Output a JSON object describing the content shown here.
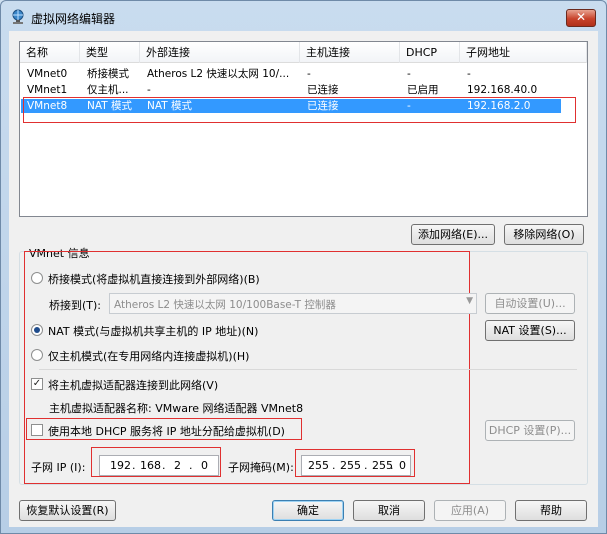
{
  "window": {
    "title": "虚拟网络编辑器"
  },
  "table": {
    "columns": [
      "名称",
      "类型",
      "外部连接",
      "主机连接",
      "DHCP",
      "子网地址"
    ],
    "rows": [
      [
        "VMnet0",
        "桥接模式",
        "Atheros L2 快速以太网 10/...",
        "-",
        "-",
        "-"
      ],
      [
        "VMnet1",
        "仅主机...",
        "-",
        "已连接",
        "已启用",
        "192.168.40.0"
      ],
      [
        "VMnet8",
        "NAT 模式",
        "NAT 模式",
        "已连接",
        "-",
        "192.168.2.0"
      ]
    ],
    "selected_row": 2
  },
  "buttons": {
    "add_network": "添加网络(E)...",
    "remove_network": "移除网络(O)",
    "auto_settings": "自动设置(U)...",
    "nat_settings": "NAT 设置(S)...",
    "dhcp_settings": "DHCP 设置(P)...",
    "restore_defaults": "恢复默认设置(R)",
    "ok": "确定",
    "cancel": "取消",
    "apply": "应用(A)",
    "help": "帮助"
  },
  "vmnet_info": {
    "group_title": "VMnet 信息",
    "bridged_label": "桥接模式(将虚拟机直接连接到外部网络)(B)",
    "bridged_to_label": "桥接到(T):",
    "bridged_to_value": "Atheros L2 快速以太网 10/100Base-T 控制器",
    "nat_label": "NAT 模式(与虚拟机共享主机的 IP 地址)(N)",
    "hostonly_label": "仅主机模式(在专用网络内连接虚拟机)(H)",
    "selected_mode": "nat",
    "connect_adapter_label": "将主机虚拟适配器连接到此网络(V)",
    "connect_adapter_checked": true,
    "adapter_name_label": "主机虚拟适配器名称: VMware 网络适配器 VMnet8",
    "use_dhcp_label": "使用本地 DHCP 服务将 IP 地址分配给虚拟机(D)",
    "use_dhcp_checked": false,
    "subnet_ip_label": "子网 IP (I):",
    "subnet_ip": [
      "192",
      "168",
      "2",
      "0"
    ],
    "subnet_mask_label": "子网掩码(M):",
    "subnet_mask": [
      "255",
      "255",
      "255",
      "0"
    ]
  },
  "colors": {
    "selection": "#3399ff",
    "highlight_box": "#e03030"
  }
}
